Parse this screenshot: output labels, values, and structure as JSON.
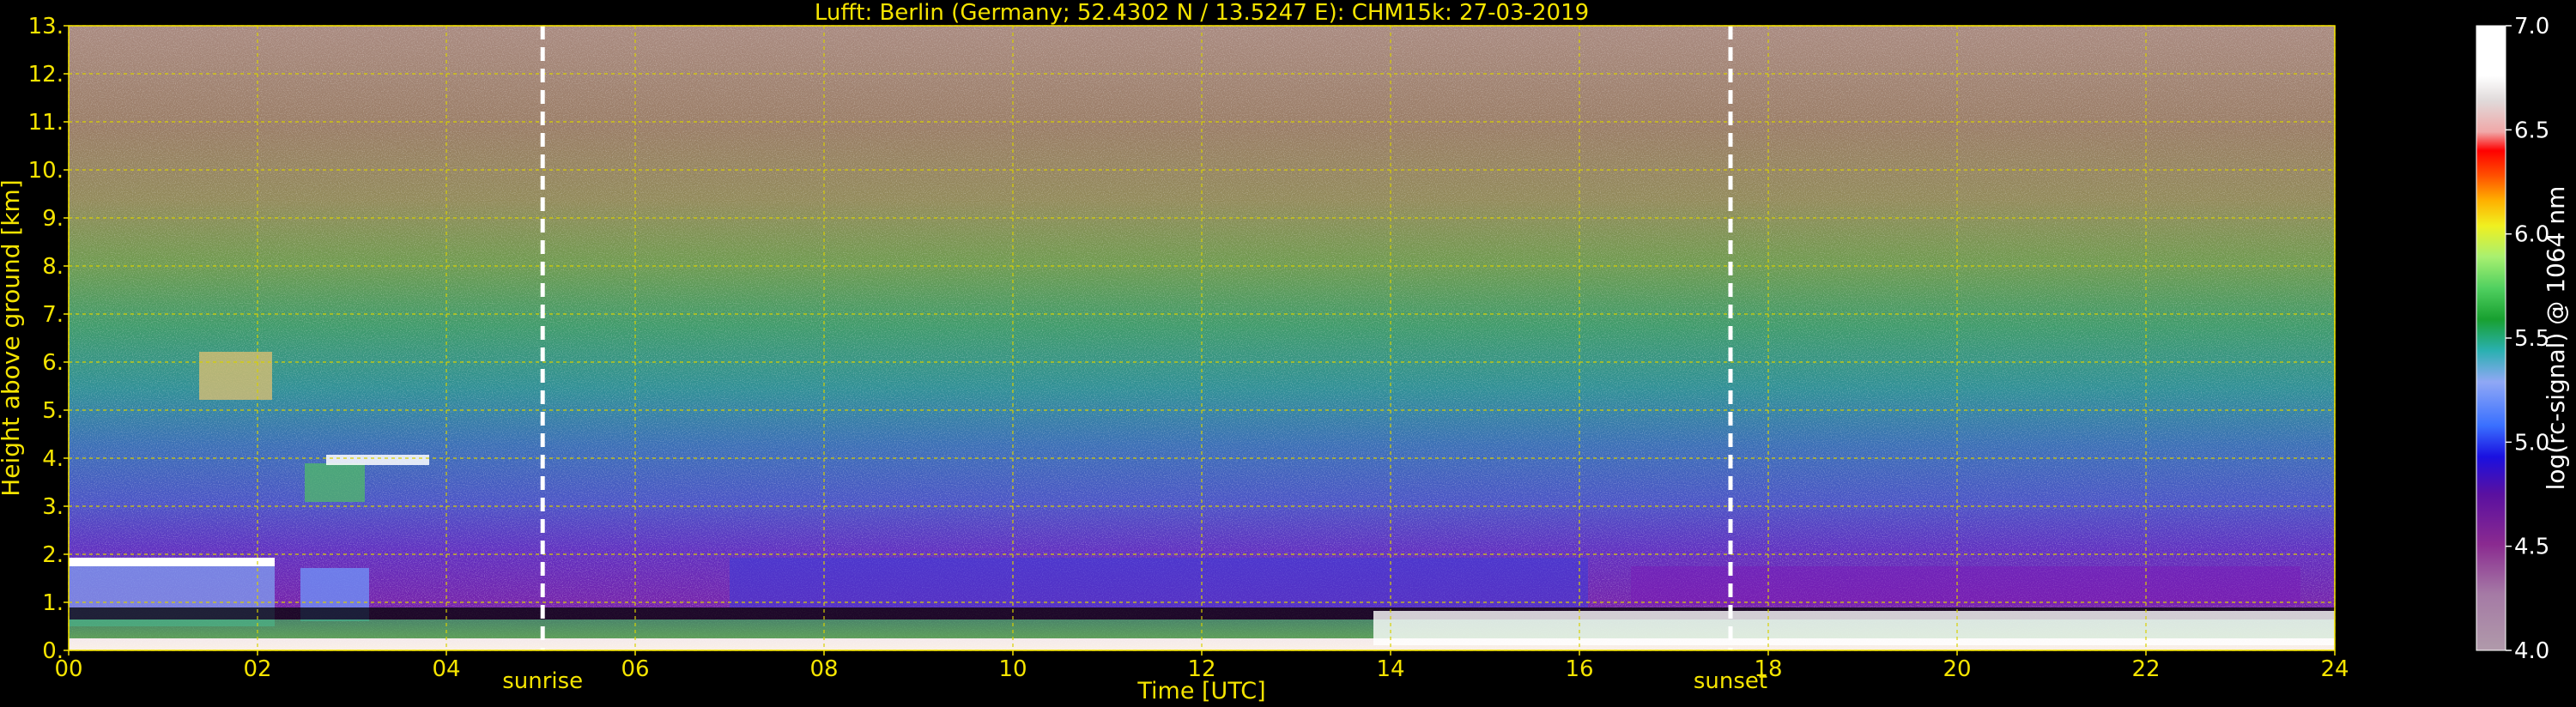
{
  "chart_data": {
    "type": "heatmap",
    "title": "Lufft: Berlin (Germany; 52.4302 N / 13.5247 E):    CHM15k: 27-03-2019",
    "xlabel": "Time [UTC]",
    "ylabel": "Height above ground [km]",
    "xlim": [
      0,
      24
    ],
    "ylim": [
      0,
      13
    ],
    "x_ticks": [
      "00",
      "02",
      "04",
      "06",
      "08",
      "10",
      "12",
      "14",
      "16",
      "18",
      "20",
      "22",
      "24"
    ],
    "y_ticks": [
      "0.",
      "1.",
      "2.",
      "3.",
      "4.",
      "5.",
      "6.",
      "7.",
      "8.",
      "9.",
      "10.",
      "11.",
      "12.",
      "13."
    ],
    "grid": true,
    "colorbar": {
      "label": "log(rc-signal) @ 1064 nm",
      "range": [
        4.0,
        7.0
      ],
      "ticks": [
        "4.0",
        "4.5",
        "5.0",
        "5.5",
        "6.0",
        "6.5",
        "7.0"
      ]
    },
    "annotations": [
      {
        "label": "sunrise",
        "x": 5.02,
        "style": "white dashed line"
      },
      {
        "label": "sunset",
        "x": 17.6,
        "style": "white dashed line"
      }
    ],
    "colors": {
      "axis_text": "#f5e400",
      "grid": "#d8d000",
      "marker_lines": "#ffffff",
      "background": "#000000"
    }
  }
}
